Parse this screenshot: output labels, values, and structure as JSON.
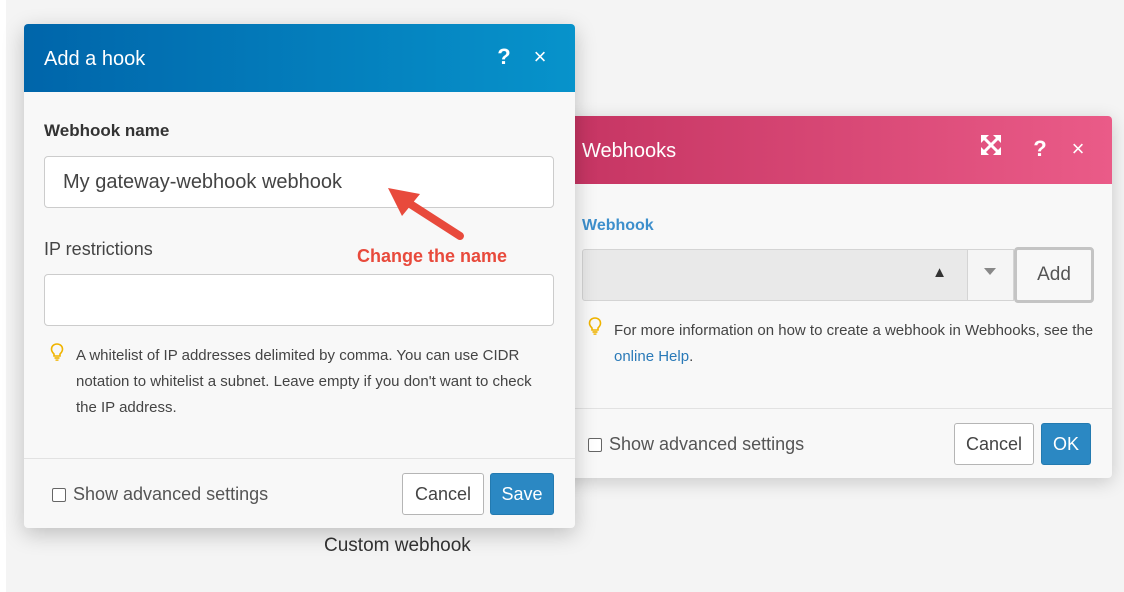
{
  "canvas": {
    "module_label": "Custom webhook"
  },
  "webhooks_dialog": {
    "title": "Webhooks",
    "header_color": "#d84470",
    "field_label": "Webhook",
    "selected_value": "",
    "add_label": "Add",
    "tip_text": "For more information on how to create a webhook in Webhooks, see the ",
    "tip_link": "online Help",
    "tip_end": ".",
    "advanced_label": "Show advanced settings",
    "cancel_label": "Cancel",
    "ok_label": "OK"
  },
  "hook_dialog": {
    "title": "Add a hook",
    "header_color": "#0078bc",
    "name_label": "Webhook name",
    "name_value": "My gateway-webhook webhook",
    "ip_label": "IP restrictions",
    "ip_value": "",
    "tip_text": "A whitelist of IP addresses delimited by comma. You can use CIDR notation to whitelist a subnet. Leave empty if you don't want to check the IP address.",
    "advanced_label": "Show advanced settings",
    "cancel_label": "Cancel",
    "save_label": "Save"
  },
  "annotation": {
    "text": "Change the name",
    "color": "#e84a3c"
  },
  "icons": {
    "help": "?",
    "close": "×",
    "expand": "expand-icon",
    "tip": "lightbulb-icon"
  },
  "accent_color": "#2b88c3"
}
